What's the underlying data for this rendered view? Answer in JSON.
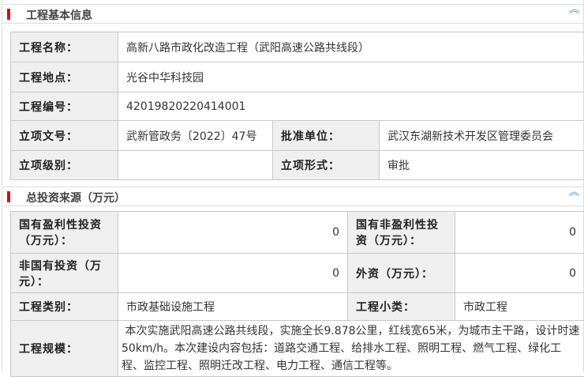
{
  "section1": {
    "title": "工程基本信息",
    "rows": {
      "name_label": "工程名称：",
      "name": "高新八路市政化改造工程（武阳高速公路共线段）",
      "location_label": "工程地点：",
      "location": "光谷中华科技园",
      "code_label": "工程编号：",
      "code": "42019820220414001",
      "doc_label": "立项文号：",
      "doc": "武新管政务〔2022〕47号",
      "approver_label": "批准单位：",
      "approver": "武汉东湖新技术开发区管理委员会",
      "level_label": "立项级别：",
      "level": "",
      "form_label": "立项形式：",
      "form": "审批"
    }
  },
  "section2": {
    "title": "总投资来源（万元）",
    "rows": {
      "state_profit_label": "国有盈利性投资（万元）：",
      "state_profit": "0",
      "state_nonprofit_label": "国有非盈利性投资（万元）：",
      "state_nonprofit": "0",
      "nonstate_label": "非国有投资（万元）：",
      "nonstate": "0",
      "foreign_label": "外资（万元）：",
      "foreign": "0",
      "category_label": "工程类别：",
      "category": "市政基础设施工程",
      "subcategory_label": "工程小类：",
      "subcategory": "市政工程",
      "scale_label": "工程规模：",
      "scale": " 本次实施武阳高速公路共线段，实施全长9.878公里，红线宽65米，为城市主干路，设计时速50km/h。本次建设内容包括：道路交通工程、给排水工程、照明工程、燃气工程、绿化工程、监控工程、照明迁改工程、电力工程、通信工程等。"
    }
  },
  "icons": {
    "collapse": "double-chevron-up-icon"
  },
  "colors": {
    "accent": "#e60012",
    "label_bg": "#efefef",
    "chevron": "#4a90d9"
  }
}
